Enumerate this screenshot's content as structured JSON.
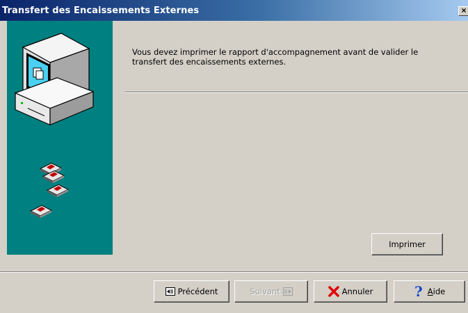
{
  "window": {
    "title": "Transfert des Encaissements Externes",
    "close_label": "×"
  },
  "message": {
    "text": "Vous devez imprimer le rapport d'accompagnement avant de valider le transfert des encaissements externes."
  },
  "buttons": {
    "print_label": "Imprimer",
    "previous_label": "Précédent",
    "next_label": "Suivant",
    "cancel_label": "Annuler",
    "help_accel": "A",
    "help_rest": "ide"
  },
  "icons": {
    "sidebar_main": "computer-icon",
    "sidebar_disks": "floppy-disk-icon",
    "previous": "previous-arrow-icon",
    "next": "next-arrow-icon",
    "cancel": "red-x-icon",
    "help": "question-mark-icon"
  },
  "colors": {
    "title_bar_start": "#0a246a",
    "title_bar_end": "#a6caf0",
    "sidebar_bg": "#008080",
    "dialog_bg": "#d4d0c8",
    "cancel_icon": "#e00000",
    "help_icon": "#1848c8"
  },
  "state": {
    "next_enabled": false
  }
}
